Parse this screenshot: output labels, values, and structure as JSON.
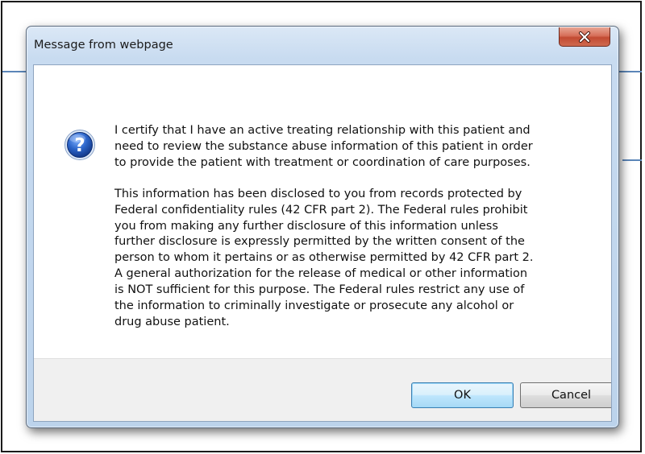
{
  "dialog": {
    "title": "Message from webpage",
    "close_icon": "close-icon",
    "message_icon": "question-icon",
    "icon_glyph": "?",
    "paragraph1": [
      "I certify that I have an active treating relationship with this patient and",
      "need to review the substance abuse information of this patient in order",
      "to provide the patient with treatment or coordination of care purposes."
    ],
    "paragraph2": [
      "This information has been disclosed to you from records protected by",
      "Federal confidentiality rules (42 CFR part 2). The Federal rules prohibit",
      "you from making any further disclosure of this information unless",
      "further disclosure is expressly permitted by the written consent of the",
      "person to whom it pertains or as otherwise permitted by 42 CFR part 2.",
      "A general authorization for the release of medical or other information",
      "is NOT sufficient for this purpose. The Federal rules restrict any use of",
      "the information to criminally investigate or prosecute any alcohol or",
      "drug abuse patient."
    ],
    "ok_label": "OK",
    "cancel_label": "Cancel"
  },
  "colors": {
    "titlebar": "#c8dbf0",
    "close_button": "#c24a32",
    "ok_focus_border": "#3c7fb1",
    "icon_blue": "#1c4fa8"
  }
}
